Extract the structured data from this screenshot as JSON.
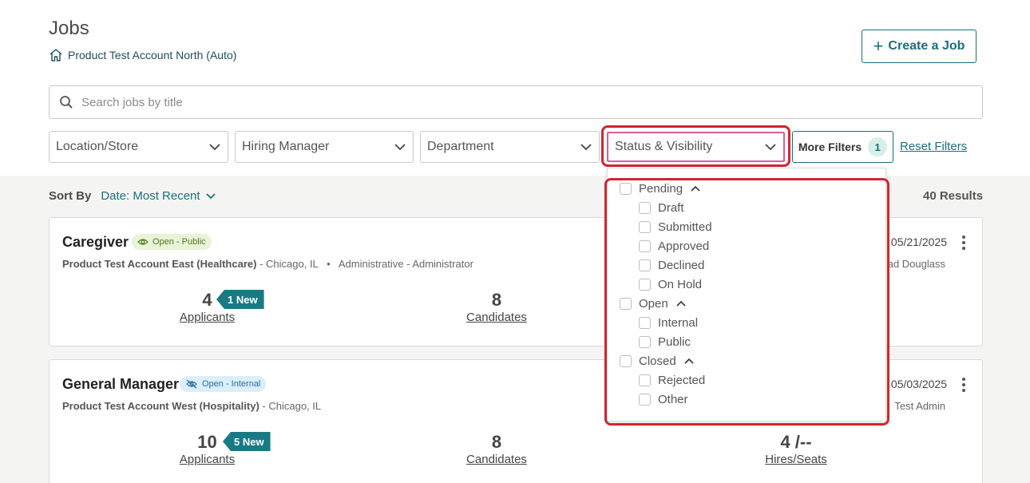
{
  "page": {
    "title": "Jobs",
    "account": "Product Test Account North (Auto)",
    "create_button": "Create a Job"
  },
  "search": {
    "placeholder": "Search jobs by title"
  },
  "filters": {
    "location": "Location/Store",
    "hiring_manager": "Hiring Manager",
    "department": "Department",
    "status": "Status & Visibility",
    "more_filters": "More Filters",
    "more_filters_count": "1",
    "reset": "Reset Filters"
  },
  "sort": {
    "label": "Sort By",
    "value": "Date: Most Recent"
  },
  "results": "40 Results",
  "status_options": {
    "pending": {
      "label": "Pending",
      "children": [
        "Draft",
        "Submitted",
        "Approved",
        "Declined",
        "On Hold"
      ]
    },
    "open": {
      "label": "Open",
      "children": [
        "Internal",
        "Public"
      ]
    },
    "closed": {
      "label": "Closed",
      "children": [
        "Rejected",
        "Other"
      ]
    }
  },
  "jobs": [
    {
      "title": "Caregiver",
      "status": "Open - Public",
      "account": "Product Test Account East (Healthcare)",
      "location": "- Chicago, IL",
      "separator": "•",
      "department": "Administrative - Administrator",
      "date": "05/21/2025",
      "owner": "ad Douglass",
      "applicants": "4",
      "new_badge": "1 New",
      "applicants_label": "Applicants",
      "candidates": "8",
      "candidates_label": "Candidates"
    },
    {
      "title": "General Manager",
      "status": "Open - Internal",
      "account": "Product Test Account West (Hospitality)",
      "location": "- Chicago, IL",
      "date": "05/03/2025",
      "owner": "Test Admin",
      "applicants": "10",
      "new_badge": "5 New",
      "applicants_label": "Applicants",
      "candidates": "8",
      "candidates_label": "Candidates",
      "hires": "4 /--",
      "hires_label": "Hires/Seats"
    }
  ]
}
